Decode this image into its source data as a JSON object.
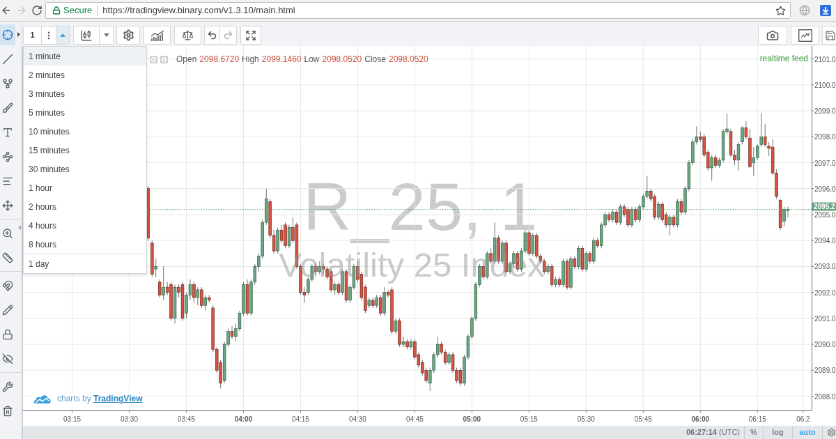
{
  "browser": {
    "nav": [
      {
        "kind": "back",
        "disabled": false
      },
      {
        "kind": "forward",
        "disabled": true
      },
      {
        "kind": "reload",
        "disabled": false
      }
    ],
    "security": "Secure",
    "url": "https://tradingview.binary.com/v1.3.10/main.html"
  },
  "left_toolbar": {
    "groups": [
      [
        {
          "kind": "crosshair",
          "selected": true
        },
        {
          "kind": "line",
          "selected": false
        },
        {
          "kind": "fork",
          "selected": false
        },
        {
          "kind": "brush",
          "selected": false
        },
        {
          "kind": "text",
          "selected": false
        },
        {
          "kind": "pattern",
          "selected": false
        },
        {
          "kind": "fibonacci",
          "selected": false
        },
        {
          "kind": "projection",
          "selected": false
        }
      ],
      [
        {
          "kind": "zoom",
          "selected": false
        },
        {
          "kind": "measure",
          "selected": false
        }
      ],
      [
        {
          "kind": "magnet",
          "selected": false
        },
        {
          "kind": "pencil",
          "selected": false
        },
        {
          "kind": "lock",
          "selected": false
        },
        {
          "kind": "hide",
          "selected": false
        }
      ],
      [
        {
          "kind": "remove",
          "selected": false
        },
        {
          "kind": "trash",
          "selected": false
        }
      ]
    ]
  },
  "top_toolbar": {
    "interval": {
      "label": "1",
      "expanded": true
    },
    "history": [
      {
        "kind": "undo",
        "disabled": false
      },
      {
        "kind": "redo",
        "disabled": true
      }
    ]
  },
  "interval_menu": {
    "items": [
      {
        "label": "1 minute",
        "selected": true
      },
      {
        "label": "2 minutes",
        "selected": false
      },
      {
        "label": "3 minutes",
        "selected": false
      },
      {
        "label": "5 minutes",
        "selected": false
      },
      {
        "label": "10 minutes",
        "selected": false
      },
      {
        "label": "15 minutes",
        "selected": false
      },
      {
        "label": "30 minutes",
        "selected": false
      },
      {
        "label": "1 hour",
        "selected": false
      },
      {
        "label": "2 hours",
        "selected": false
      },
      {
        "label": "4 hours",
        "selected": false
      },
      {
        "label": "8 hours",
        "selected": false
      }
    ],
    "more_items": [
      {
        "label": "1 day",
        "selected": false
      }
    ]
  },
  "ohlc_legend": [
    {
      "label": "Open",
      "value": "2098.6720"
    },
    {
      "label": "High",
      "value": "2099.1460"
    },
    {
      "label": "Low",
      "value": "2098.0520"
    },
    {
      "label": "Close",
      "value": "2098.0520"
    }
  ],
  "feed_status": "realtime feed",
  "watermark": {
    "symbol": "R_25, 1",
    "description": "Volatility 25 Index"
  },
  "branding": {
    "text": "charts by",
    "link": "TradingView"
  },
  "chart": {
    "chart_data": [
      {
        "type": "candlestick",
        "grid": true,
        "xlim": [
          3.035,
          6.487
        ],
        "ylim": [
          2087.45,
          2101.5
        ],
        "xticks": [
          {
            "value": 3.25,
            "label": "03:15"
          },
          {
            "value": 3.5,
            "label": "03:30"
          },
          {
            "value": 3.75,
            "label": "03:45"
          },
          {
            "value": 4,
            "label": "04:00"
          },
          {
            "value": 4.25,
            "label": "04:15"
          },
          {
            "value": 4.5,
            "label": "04:30"
          },
          {
            "value": 4.75,
            "label": "04:45"
          },
          {
            "value": 5,
            "label": "05:00"
          },
          {
            "value": 5.25,
            "label": "05:15"
          },
          {
            "value": 5.5,
            "label": "05:30"
          },
          {
            "value": 5.75,
            "label": "05:45"
          },
          {
            "value": 6,
            "label": "06:00"
          },
          {
            "value": 6.25,
            "label": "06:15"
          },
          {
            "value": 6.45,
            "label": "06:2"
          }
        ],
        "yticks": [
          {
            "value": 2088,
            "label": "2088.0"
          },
          {
            "value": 2089,
            "label": "2089.0"
          },
          {
            "value": 2090,
            "label": "2090.0"
          },
          {
            "value": 2091,
            "label": "2091.0"
          },
          {
            "value": 2092,
            "label": "2092.0"
          },
          {
            "value": 2093,
            "label": "2093.0"
          },
          {
            "value": 2094,
            "label": "2094.0"
          },
          {
            "value": 2095,
            "label": "2095.0"
          },
          {
            "value": 2096,
            "label": "2096.0"
          },
          {
            "value": 2097,
            "label": "2097.0"
          },
          {
            "value": 2098,
            "label": "2098.0"
          },
          {
            "value": 2099,
            "label": "2099.0"
          },
          {
            "value": 2100,
            "label": "2100.0"
          },
          {
            "value": 2101,
            "label": "2101.0"
          }
        ],
        "ref_lines": [
          {
            "axis": "y",
            "value": 2095.2,
            "label": "2095.2",
            "color": "#6ba583",
            "line_style": "dotted"
          }
        ],
        "x": [
          3.5833,
          3.6,
          3.6167,
          3.6333,
          3.65,
          3.6667,
          3.6833,
          3.7,
          3.7167,
          3.7333,
          3.75,
          3.7667,
          3.7833,
          3.8,
          3.8167,
          3.8333,
          3.85,
          3.8667,
          3.8833,
          3.9,
          3.9167,
          3.9333,
          3.95,
          3.9667,
          3.9833,
          4,
          4.0167,
          4.0333,
          4.05,
          4.0667,
          4.0833,
          4.1,
          4.1167,
          4.1333,
          4.15,
          4.1667,
          4.1833,
          4.2,
          4.2167,
          4.2333,
          4.25,
          4.2667,
          4.2833,
          4.3,
          4.3167,
          4.3333,
          4.35,
          4.3667,
          4.3833,
          4.4,
          4.4167,
          4.4333,
          4.45,
          4.4667,
          4.4833,
          4.5,
          4.5167,
          4.5333,
          4.55,
          4.5667,
          4.5833,
          4.6,
          4.6167,
          4.6333,
          4.65,
          4.6667,
          4.6833,
          4.7,
          4.7167,
          4.7333,
          4.75,
          4.7667,
          4.7833,
          4.8,
          4.8167,
          4.8333,
          4.85,
          4.8667,
          4.8833,
          4.9,
          4.9167,
          4.9333,
          4.95,
          4.9667,
          4.9833,
          5,
          5.0167,
          5.0333,
          5.05,
          5.0667,
          5.0833,
          5.1,
          5.1167,
          5.1333,
          5.15,
          5.1667,
          5.1833,
          5.2,
          5.2167,
          5.2333,
          5.25,
          5.2667,
          5.2833,
          5.3,
          5.3167,
          5.3333,
          5.35,
          5.3667,
          5.3833,
          5.4,
          5.4167,
          5.4333,
          5.45,
          5.4667,
          5.4833,
          5.5,
          5.5167,
          5.5333,
          5.55,
          5.5667,
          5.5833,
          5.6,
          5.6167,
          5.6333,
          5.65,
          5.6667,
          5.6833,
          5.7,
          5.7167,
          5.7333,
          5.75,
          5.7667,
          5.7833,
          5.8,
          5.8167,
          5.8333,
          5.85,
          5.8667,
          5.8833,
          5.9,
          5.9167,
          5.9333,
          5.95,
          5.9667,
          5.9833,
          6,
          6.0167,
          6.0333,
          6.05,
          6.0667,
          6.0833,
          6.1,
          6.1167,
          6.1333,
          6.15,
          6.1667,
          6.1833,
          6.2,
          6.2167,
          6.2333,
          6.25,
          6.2667,
          6.2833,
          6.3,
          6.3167,
          6.3333,
          6.35,
          6.3667,
          6.3833
        ],
        "ohlc": [
          [
            2096.0,
            2096.1,
            2094.0,
            2094.1
          ],
          [
            2093.9,
            2094.0,
            2092.6,
            2092.7
          ],
          [
            2092.9,
            2093.3,
            2092.6,
            2093.0
          ],
          [
            2092.4,
            2092.5,
            2091.8,
            2091.9
          ],
          [
            2091.9,
            2093.0,
            2091.7,
            2092.2
          ],
          [
            2092.2,
            2092.4,
            2091.9,
            2092.0
          ],
          [
            2092.3,
            2092.4,
            2090.9,
            2091.0
          ],
          [
            2091.0,
            2092.3,
            2090.8,
            2092.2
          ],
          [
            2092.2,
            2092.3,
            2091.8,
            2092.0
          ],
          [
            2092.3,
            2092.4,
            2090.9,
            2091.0
          ],
          [
            2091.2,
            2092.0,
            2091.0,
            2091.9
          ],
          [
            2091.9,
            2092.5,
            2091.7,
            2092.3
          ],
          [
            2092.3,
            2092.4,
            2091.6,
            2091.8
          ],
          [
            2091.8,
            2092.2,
            2091.5,
            2092.1
          ],
          [
            2092.1,
            2092.2,
            2091.4,
            2091.5
          ],
          [
            2091.5,
            2091.9,
            2091.3,
            2091.8
          ],
          [
            2091.8,
            2091.9,
            2091.6,
            2091.7
          ],
          [
            2091.4,
            2091.5,
            2089.7,
            2089.8
          ],
          [
            2089.8,
            2089.9,
            2088.9,
            2089.0
          ],
          [
            2089.3,
            2089.4,
            2088.3,
            2088.5
          ],
          [
            2088.6,
            2090.1,
            2088.5,
            2090.0
          ],
          [
            2090.0,
            2090.6,
            2089.9,
            2090.5
          ],
          [
            2090.5,
            2090.7,
            2090.2,
            2090.3
          ],
          [
            2090.3,
            2090.8,
            2090.1,
            2090.6
          ],
          [
            2090.6,
            2091.3,
            2090.5,
            2091.2
          ],
          [
            2091.2,
            2092.4,
            2091.1,
            2092.3
          ],
          [
            2092.3,
            2092.5,
            2091.1,
            2091.2
          ],
          [
            2091.2,
            2092.5,
            2091.1,
            2092.4
          ],
          [
            2092.4,
            2093.1,
            2092.3,
            2093.0
          ],
          [
            2093.0,
            2093.5,
            2092.8,
            2093.4
          ],
          [
            2093.4,
            2094.8,
            2093.3,
            2094.7
          ],
          [
            2094.7,
            2096.0,
            2094.6,
            2095.6
          ],
          [
            2095.5,
            2095.6,
            2094.1,
            2094.2
          ],
          [
            2094.2,
            2094.4,
            2093.5,
            2093.6
          ],
          [
            2093.6,
            2094.5,
            2093.5,
            2094.4
          ],
          [
            2094.4,
            2094.6,
            2093.9,
            2094.0
          ],
          [
            2094.6,
            2094.7,
            2093.7,
            2093.8
          ],
          [
            2093.8,
            2094.6,
            2093.7,
            2094.5
          ],
          [
            2094.5,
            2094.9,
            2093.9,
            2094.0
          ],
          [
            2094.6,
            2094.7,
            2092.9,
            2093.0
          ],
          [
            2093.0,
            2093.1,
            2091.9,
            2092.0
          ],
          [
            2092.0,
            2092.2,
            2091.6,
            2091.9
          ],
          [
            2092.0,
            2092.6,
            2091.9,
            2092.5
          ],
          [
            2092.5,
            2093.1,
            2092.4,
            2093.0
          ],
          [
            2093.0,
            2093.1,
            2092.6,
            2092.8
          ],
          [
            2092.8,
            2093.2,
            2092.7,
            2093.0
          ],
          [
            2093.0,
            2093.1,
            2092.7,
            2092.9
          ],
          [
            2092.9,
            2093.0,
            2092.5,
            2092.6
          ],
          [
            2092.8,
            2092.9,
            2092.0,
            2092.1
          ],
          [
            2092.1,
            2092.4,
            2091.9,
            2092.3
          ],
          [
            2092.3,
            2092.4,
            2091.9,
            2092.0
          ],
          [
            2092.0,
            2092.9,
            2091.9,
            2092.8
          ],
          [
            2092.8,
            2092.9,
            2091.6,
            2091.7
          ],
          [
            2091.7,
            2092.3,
            2091.6,
            2092.2
          ],
          [
            2092.2,
            2093.1,
            2092.1,
            2093.0
          ],
          [
            2093.0,
            2093.2,
            2092.4,
            2092.5
          ],
          [
            2092.7,
            2092.8,
            2091.7,
            2091.8
          ],
          [
            2092.2,
            2092.3,
            2091.2,
            2091.3
          ],
          [
            2091.5,
            2091.8,
            2091.4,
            2091.7
          ],
          [
            2091.7,
            2091.8,
            2091.4,
            2091.5
          ],
          [
            2091.5,
            2091.9,
            2091.4,
            2091.8
          ],
          [
            2091.8,
            2091.9,
            2091.1,
            2091.2
          ],
          [
            2091.2,
            2092.2,
            2091.1,
            2092.0
          ],
          [
            2092.0,
            2092.1,
            2091.8,
            2091.9
          ],
          [
            2092.1,
            2092.2,
            2090.4,
            2090.5
          ],
          [
            2090.5,
            2091.0,
            2090.4,
            2090.9
          ],
          [
            2090.9,
            2091.0,
            2089.9,
            2090.0
          ],
          [
            2090.0,
            2090.3,
            2089.9,
            2090.1
          ],
          [
            2090.1,
            2090.2,
            2089.8,
            2089.9
          ],
          [
            2089.9,
            2090.2,
            2089.8,
            2090.1
          ],
          [
            2090.1,
            2090.2,
            2089.4,
            2089.5
          ],
          [
            2089.6,
            2089.7,
            2089.1,
            2089.2
          ],
          [
            2089.3,
            2089.4,
            2088.8,
            2088.9
          ],
          [
            2089.0,
            2089.1,
            2088.5,
            2088.6
          ],
          [
            2088.5,
            2089.1,
            2088.2,
            2089.0
          ],
          [
            2089.0,
            2089.7,
            2088.9,
            2089.6
          ],
          [
            2089.6,
            2090.3,
            2089.5,
            2090.0
          ],
          [
            2090.0,
            2090.1,
            2089.6,
            2089.7
          ],
          [
            2089.7,
            2089.8,
            2089.2,
            2089.3
          ],
          [
            2089.3,
            2089.7,
            2089.2,
            2089.6
          ],
          [
            2089.6,
            2089.7,
            2088.9,
            2089.0
          ],
          [
            2089.0,
            2089.1,
            2088.5,
            2088.6
          ],
          [
            2089.0,
            2089.1,
            2088.4,
            2088.5
          ],
          [
            2088.5,
            2089.6,
            2088.4,
            2089.5
          ],
          [
            2089.5,
            2090.4,
            2089.4,
            2090.3
          ],
          [
            2090.3,
            2091.1,
            2090.2,
            2091.0
          ],
          [
            2091.0,
            2092.4,
            2090.9,
            2092.3
          ],
          [
            2092.3,
            2093.1,
            2092.2,
            2093.0
          ],
          [
            2093.0,
            2093.2,
            2092.5,
            2092.6
          ],
          [
            2092.6,
            2093.6,
            2092.5,
            2093.5
          ],
          [
            2093.5,
            2093.7,
            2093.1,
            2093.2
          ],
          [
            2093.2,
            2094.7,
            2093.1,
            2094.1
          ],
          [
            2094.1,
            2094.2,
            2093.1,
            2093.2
          ],
          [
            2093.2,
            2094.0,
            2093.1,
            2093.9
          ],
          [
            2093.9,
            2094.0,
            2092.7,
            2092.8
          ],
          [
            2092.8,
            2093.2,
            2092.7,
            2093.1
          ],
          [
            2093.1,
            2093.6,
            2093.0,
            2093.5
          ],
          [
            2093.5,
            2093.6,
            2092.8,
            2092.9
          ],
          [
            2092.9,
            2093.7,
            2092.8,
            2093.6
          ],
          [
            2093.6,
            2094.4,
            2093.5,
            2094.3
          ],
          [
            2094.3,
            2094.4,
            2093.4,
            2093.5
          ],
          [
            2093.5,
            2094.3,
            2093.4,
            2094.2
          ],
          [
            2094.2,
            2094.3,
            2093.3,
            2093.4
          ],
          [
            2093.4,
            2093.5,
            2093.1,
            2093.2
          ],
          [
            2093.2,
            2093.3,
            2092.7,
            2092.8
          ],
          [
            2092.8,
            2093.1,
            2092.7,
            2093.0
          ],
          [
            2093.0,
            2093.1,
            2092.2,
            2092.3
          ],
          [
            2092.3,
            2092.6,
            2092.2,
            2092.5
          ],
          [
            2092.5,
            2092.6,
            2092.2,
            2092.3
          ],
          [
            2092.3,
            2093.3,
            2092.2,
            2093.2
          ],
          [
            2093.2,
            2093.3,
            2092.1,
            2092.2
          ],
          [
            2092.2,
            2093.4,
            2092.1,
            2093.3
          ],
          [
            2093.3,
            2093.4,
            2092.9,
            2093.0
          ],
          [
            2093.0,
            2093.8,
            2092.9,
            2093.7
          ],
          [
            2093.7,
            2093.8,
            2092.8,
            2092.9
          ],
          [
            2092.9,
            2093.6,
            2092.8,
            2093.5
          ],
          [
            2093.5,
            2093.6,
            2093.1,
            2093.2
          ],
          [
            2093.2,
            2094.1,
            2093.1,
            2094.0
          ],
          [
            2094.0,
            2094.1,
            2093.7,
            2093.8
          ],
          [
            2093.8,
            2094.7,
            2093.7,
            2094.6
          ],
          [
            2094.6,
            2095.1,
            2094.5,
            2095.0
          ],
          [
            2095.0,
            2095.1,
            2094.7,
            2094.8
          ],
          [
            2094.8,
            2095.2,
            2094.7,
            2095.1
          ],
          [
            2095.1,
            2095.2,
            2094.6,
            2094.7
          ],
          [
            2094.7,
            2095.4,
            2094.6,
            2095.3
          ],
          [
            2095.3,
            2095.4,
            2094.9,
            2095.0
          ],
          [
            2095.2,
            2095.3,
            2094.5,
            2094.6
          ],
          [
            2094.6,
            2095.3,
            2094.5,
            2095.2
          ],
          [
            2095.2,
            2095.3,
            2094.7,
            2094.8
          ],
          [
            2094.8,
            2095.4,
            2094.7,
            2095.3
          ],
          [
            2095.3,
            2095.8,
            2095.2,
            2095.7
          ],
          [
            2095.7,
            2096.5,
            2095.6,
            2095.9
          ],
          [
            2095.9,
            2096.0,
            2095.5,
            2095.6
          ],
          [
            2095.7,
            2095.8,
            2094.8,
            2094.9
          ],
          [
            2094.9,
            2095.5,
            2094.8,
            2095.4
          ],
          [
            2095.4,
            2095.5,
            2094.7,
            2094.8
          ],
          [
            2095.0,
            2095.1,
            2094.5,
            2094.6
          ],
          [
            2094.6,
            2095.0,
            2094.2,
            2094.9
          ],
          [
            2094.9,
            2095.0,
            2094.5,
            2094.6
          ],
          [
            2094.6,
            2095.6,
            2094.5,
            2095.5
          ],
          [
            2095.5,
            2095.6,
            2095.0,
            2095.1
          ],
          [
            2095.1,
            2096.1,
            2095.0,
            2096.0
          ],
          [
            2096.0,
            2097.1,
            2095.9,
            2097.0
          ],
          [
            2097.0,
            2097.9,
            2096.9,
            2097.8
          ],
          [
            2097.8,
            2098.4,
            2097.7,
            2098.0
          ],
          [
            2098.0,
            2098.2,
            2097.8,
            2097.9
          ],
          [
            2098.0,
            2098.1,
            2097.2,
            2097.3
          ],
          [
            2097.4,
            2097.5,
            2096.7,
            2096.8
          ],
          [
            2096.8,
            2097.3,
            2096.3,
            2097.2
          ],
          [
            2097.2,
            2097.3,
            2096.8,
            2096.9
          ],
          [
            2096.9,
            2097.2,
            2096.8,
            2097.1
          ],
          [
            2097.1,
            2098.3,
            2097.0,
            2098.2
          ],
          [
            2098.2,
            2098.9,
            2098.1,
            2098.3
          ],
          [
            2098.2,
            2098.3,
            2097.2,
            2097.3
          ],
          [
            2097.3,
            2097.5,
            2096.9,
            2097.1
          ],
          [
            2097.1,
            2097.8,
            2096.7,
            2097.7
          ],
          [
            2097.8,
            2098.4,
            2097.7,
            2098.35
          ],
          [
            2098.35,
            2098.6,
            2097.9,
            2098.0
          ],
          [
            2097.95,
            2098.3,
            2096.8,
            2096.85
          ],
          [
            2097.0,
            2097.6,
            2096.5,
            2097.2
          ],
          [
            2097.2,
            2097.7,
            2097.1,
            2097.65
          ],
          [
            2097.7,
            2098.9,
            2097.6,
            2098.0
          ],
          [
            2098.0,
            2098.5,
            2097.6,
            2097.7
          ],
          [
            2097.65,
            2097.8,
            2097.25,
            2097.55
          ],
          [
            2097.6,
            2097.9,
            2096.55,
            2096.6
          ],
          [
            2096.6,
            2096.75,
            2095.6,
            2095.7
          ],
          [
            2095.55,
            2095.6,
            2094.4,
            2094.5
          ],
          [
            2094.75,
            2095.3,
            2094.55,
            2095.2
          ],
          [
            2095.15,
            2095.3,
            2094.9,
            2095.2
          ]
        ]
      }
    ]
  },
  "bottom_bar": {
    "clock": "**06:27:14** (UTC)",
    "scale_options": [
      {
        "label": "%",
        "on": false
      },
      {
        "label": "log",
        "on": false
      },
      {
        "label": "auto",
        "on": true
      }
    ]
  }
}
